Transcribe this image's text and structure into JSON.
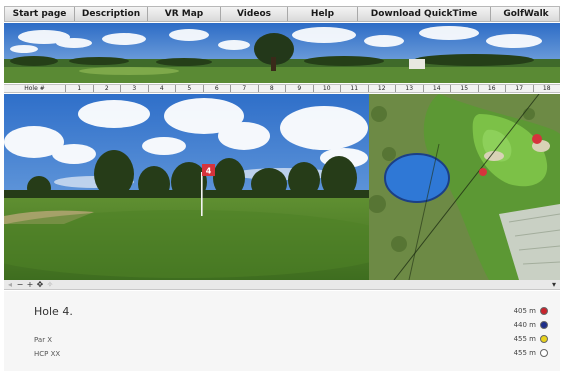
{
  "nav": [
    {
      "label": "Start page"
    },
    {
      "label": "Description"
    },
    {
      "label": "VR Map"
    },
    {
      "label": "Videos"
    },
    {
      "label": "Help"
    },
    {
      "label": "Download QuickTime"
    },
    {
      "label": "GolfWalk"
    }
  ],
  "ruler": {
    "label": "Hole #",
    "holes": [
      "1",
      "2",
      "3",
      "4",
      "5",
      "6",
      "7",
      "8",
      "9",
      "10",
      "11",
      "12",
      "13",
      "14",
      "15",
      "16",
      "17",
      "18"
    ]
  },
  "flag": {
    "number": "4",
    "color": "#d6333c"
  },
  "info": {
    "hole_title": "Hole 4.",
    "par": "Par X",
    "hcp": "HCP XX",
    "tees": [
      {
        "distance": "405 m",
        "color": "#c8232c"
      },
      {
        "distance": "440 m",
        "color": "#1f2f8a"
      },
      {
        "distance": "455 m",
        "color": "#e8d21c"
      },
      {
        "distance": "455 m",
        "color": "#ffffff"
      }
    ]
  }
}
